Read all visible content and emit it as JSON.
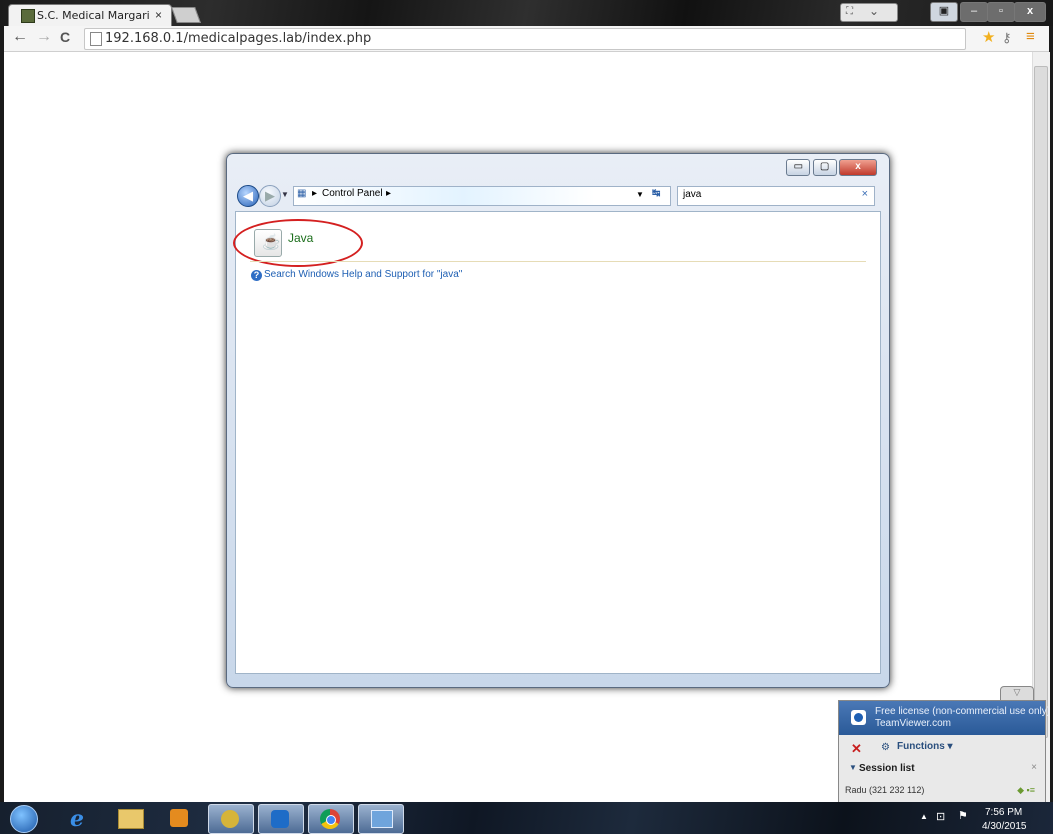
{
  "browser": {
    "tab_title": "S.C. Medical Margarit S.R.L",
    "tab_close": "×",
    "url": "192.168.0.1/medicalpages.lab/index.php",
    "back_glyph": "←",
    "forward_glyph": "→",
    "reload_glyph": "C",
    "bookmark_glyph": "★",
    "menu_glyph": "≡",
    "win_min": "–",
    "win_max": "▫",
    "win_close": "x"
  },
  "control_panel": {
    "breadcrumb_root": "Control Panel",
    "breadcrumb_sep": "▸",
    "search_value": "java",
    "search_clear": "×",
    "result_label": "Java",
    "help_link": "Search Windows Help and Support for \"java\"",
    "help_glyph": "?",
    "cap_close": "x"
  },
  "teamviewer": {
    "line1": "Free license (non-commercial use only)",
    "line2": "TeamViewer.com",
    "functions_label": "Functions ▾",
    "close_glyph": "✕",
    "session_label": "Session list",
    "session_close": "×",
    "session_item": "Radu (321 232 112)",
    "tab_glyph": "▽"
  },
  "taskbar": {
    "time": "7:56 PM",
    "date": "4/30/2015"
  }
}
